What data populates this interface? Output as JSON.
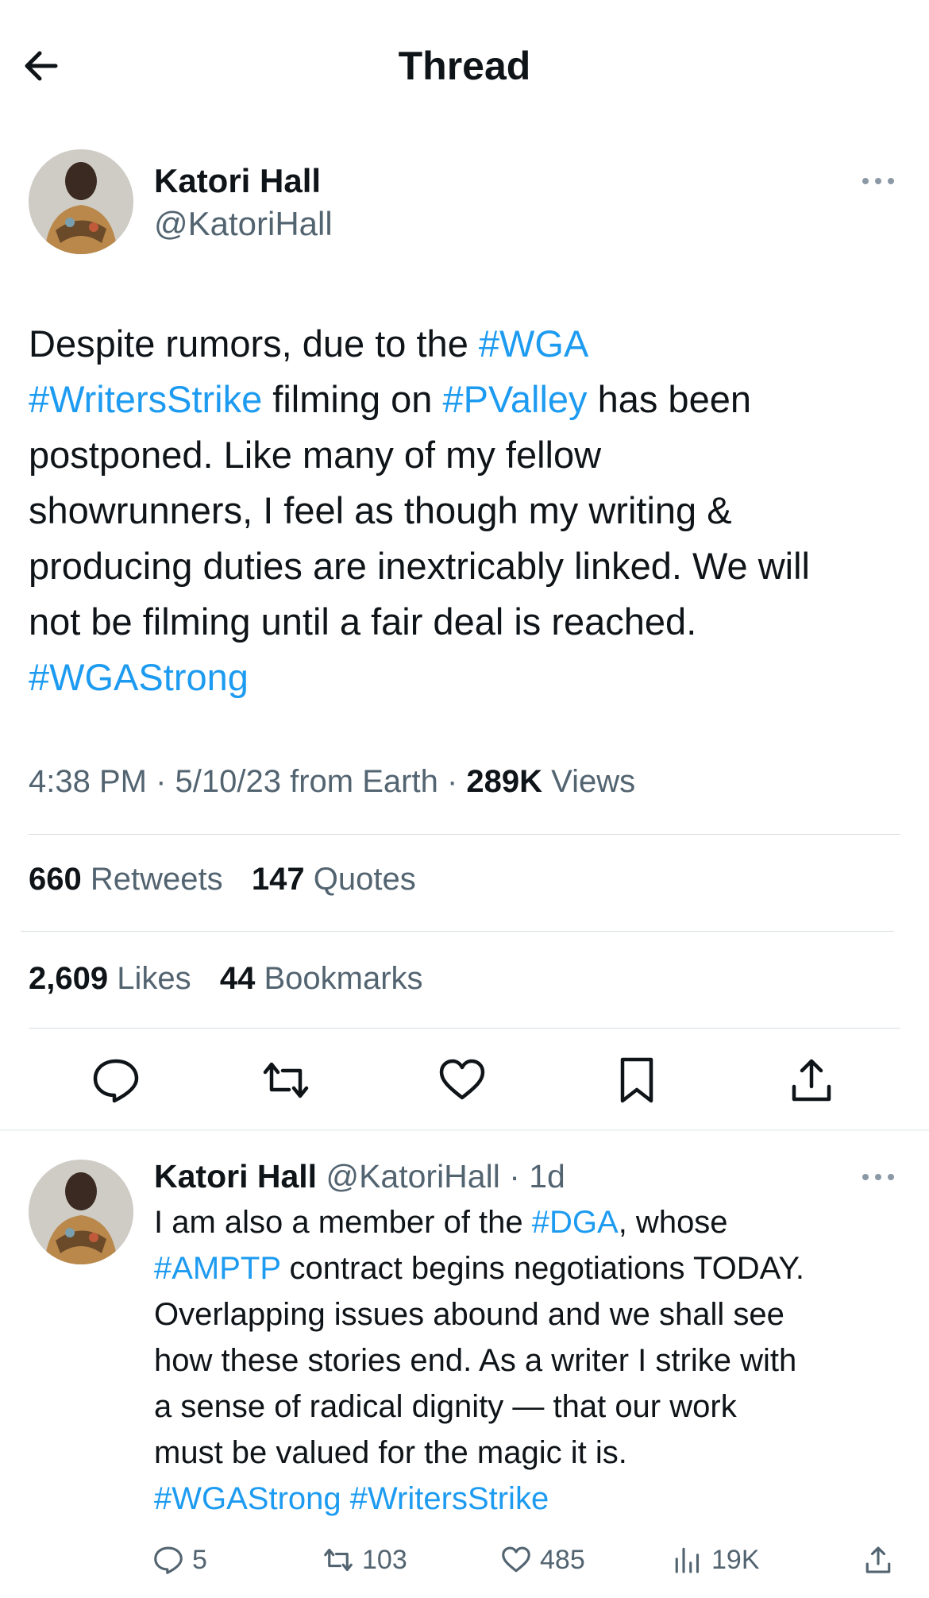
{
  "header": {
    "title": "Thread"
  },
  "main_tweet": {
    "name": "Katori Hall",
    "handle": "@KatoriHall",
    "lines": [
      [
        {
          "t": "Despite rumors, due to the "
        },
        {
          "t": "#WGA",
          "link": true
        }
      ],
      [
        {
          "t": "#WritersStrike",
          "link": true
        },
        {
          "t": " filming on "
        },
        {
          "t": "#PValley",
          "link": true
        },
        {
          "t": " has been"
        }
      ],
      [
        {
          "t": "postponed. Like many of my fellow"
        }
      ],
      [
        {
          "t": "showrunners, I feel as though my writing &"
        }
      ],
      [
        {
          "t": "producing duties are inextricably linked. We will"
        }
      ],
      [
        {
          "t": "not be filming until a fair deal is reached."
        }
      ],
      [
        {
          "t": "#WGAStrong",
          "link": true
        }
      ]
    ],
    "meta": {
      "time": "4:38 PM",
      "date": "5/10/23",
      "source": "from Earth",
      "views_count": "289K",
      "views_label": "Views"
    },
    "stats": {
      "retweets_count": "660",
      "retweets_label": "Retweets",
      "quotes_count": "147",
      "quotes_label": "Quotes",
      "likes_count": "2,609",
      "likes_label": "Likes",
      "bookmarks_count": "44",
      "bookmarks_label": "Bookmarks"
    }
  },
  "reply_tweet": {
    "name": "Katori Hall",
    "handle": "@KatoriHall",
    "time": "1d",
    "lines": [
      [
        {
          "t": "I am also a member of the "
        },
        {
          "t": "#DGA",
          "link": true
        },
        {
          "t": ", whose"
        }
      ],
      [
        {
          "t": "#AMPTP",
          "link": true
        },
        {
          "t": " contract begins negotiations TODAY."
        }
      ],
      [
        {
          "t": "Overlapping issues abound and we shall see"
        }
      ],
      [
        {
          "t": "how these stories end. As a writer I strike with"
        }
      ],
      [
        {
          "t": "a sense of radical dignity — that our work"
        }
      ],
      [
        {
          "t": "must be valued for the magic it is."
        }
      ],
      [
        {
          "t": "#WGAStrong",
          "link": true
        },
        {
          "t": " "
        },
        {
          "t": "#WritersStrike",
          "link": true
        }
      ]
    ],
    "actions": {
      "replies": "5",
      "retweets": "103",
      "likes": "485",
      "views": "19K"
    }
  },
  "colors": {
    "link": "#1d9bf0",
    "muted": "#536471",
    "text": "#0f1419",
    "divider": "#d9dde1"
  },
  "icons": [
    "back-arrow-icon",
    "more-icon",
    "reply-icon",
    "retweet-icon",
    "like-icon",
    "bookmark-icon",
    "share-icon",
    "views-icon"
  ]
}
